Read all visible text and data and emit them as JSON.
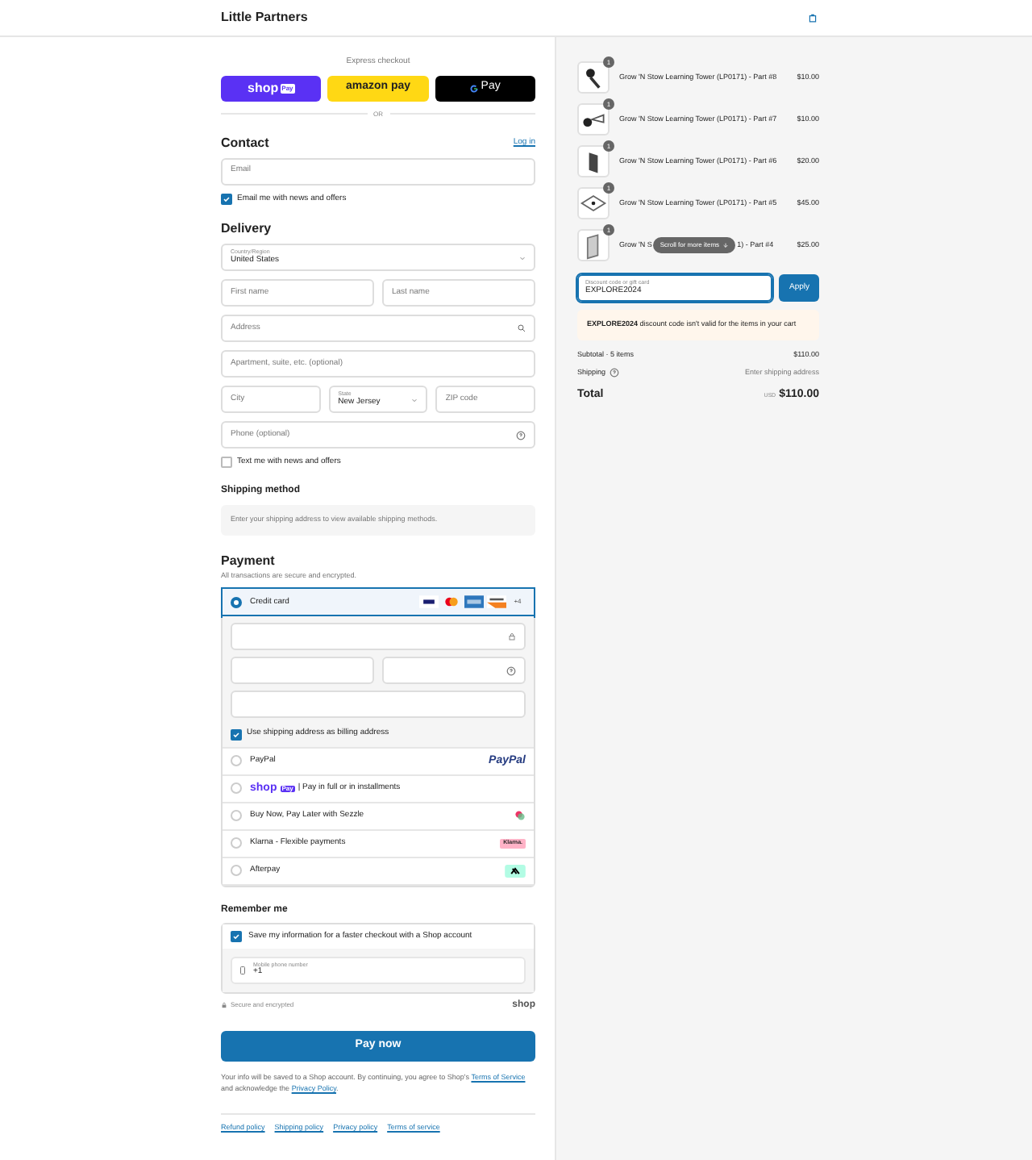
{
  "header": {
    "store": "Little Partners"
  },
  "express": {
    "title": "Express checkout",
    "buttons": [
      {
        "kind": "shop",
        "label": "shop",
        "tag": "Pay"
      },
      {
        "kind": "amazon",
        "label": "amazon pay"
      },
      {
        "kind": "gpay",
        "label": "Pay"
      }
    ],
    "divider": "OR"
  },
  "contact": {
    "title": "Contact",
    "login": "Log in",
    "email": {
      "placeholder": "Email"
    },
    "news": {
      "label": "Email me with news and offers",
      "checked": true
    }
  },
  "delivery": {
    "title": "Delivery",
    "country": {
      "label": "Country/Region",
      "value": "United States"
    },
    "first_name": {
      "placeholder": "First name"
    },
    "last_name": {
      "placeholder": "Last name"
    },
    "address": {
      "placeholder": "Address"
    },
    "apartment": {
      "placeholder": "Apartment, suite, etc. (optional)"
    },
    "city": {
      "placeholder": "City"
    },
    "state": {
      "label": "State",
      "value": "New Jersey"
    },
    "zip": {
      "placeholder": "ZIP code"
    },
    "phone": {
      "placeholder": "Phone (optional)"
    },
    "sms": {
      "label": "Text me with news and offers",
      "checked": false
    }
  },
  "shipping_method": {
    "title": "Shipping method",
    "message": "Enter your shipping address to view available shipping methods."
  },
  "payment": {
    "title": "Payment",
    "subtitle": "All transactions are secure and encrypted.",
    "billing": {
      "label": "Use shipping address as billing address",
      "checked": true
    },
    "methods": [
      {
        "kind": "card",
        "label": "Credit card",
        "selected": true,
        "more": "+4"
      },
      {
        "kind": "paypal",
        "label": "PayPal",
        "logo": "PayPal",
        "selected": false
      },
      {
        "kind": "shop",
        "logo": "shop",
        "tag": "Pay",
        "label": "| Pay in full or in installments",
        "selected": false
      },
      {
        "kind": "sezzle",
        "label": "Buy Now, Pay Later with Sezzle",
        "selected": false
      },
      {
        "kind": "klarna",
        "label": "Klarna - Flexible payments",
        "logo": "Klarna.",
        "selected": false
      },
      {
        "kind": "afterpay",
        "label": "Afterpay",
        "selected": false
      }
    ]
  },
  "remember": {
    "title": "Remember me",
    "save": {
      "label": "Save my information for a faster checkout with a Shop account",
      "checked": true
    },
    "phone": {
      "label": "Mobile phone number",
      "value": "+1"
    },
    "secure": "Secure and encrypted",
    "shop_logo": "shop"
  },
  "pay_button": "Pay now",
  "notice": {
    "before": "Your info will be saved to a Shop account. By continuing, you agree to Shop's",
    "terms": "Terms of Service",
    "middle": "and acknowledge the",
    "privacy": "Privacy Policy",
    "after": "."
  },
  "footer": {
    "links": [
      "Refund policy",
      "Shipping policy",
      "Privacy policy",
      "Terms of service"
    ]
  },
  "cart": {
    "items": [
      {
        "kind": "full",
        "quantity": "1",
        "name": "Grow 'N Stow Learning Tower (LP0171) - Part #8",
        "price": "$10.00"
      },
      {
        "kind": "full",
        "quantity": "1",
        "name": "Grow 'N Stow Learning Tower (LP0171) - Part #7",
        "price": "$10.00"
      },
      {
        "kind": "full",
        "quantity": "1",
        "name": "Grow 'N Stow Learning Tower (LP0171) - Part #6",
        "price": "$20.00"
      },
      {
        "kind": "full",
        "quantity": "1",
        "name": "Grow 'N Stow Learning Tower (LP0171) - Part #5",
        "price": "$45.00"
      },
      {
        "kind": "covered",
        "quantity": "1",
        "name_start": "Grow 'N S",
        "name_end": "1) - Part #4",
        "price": "$25.00"
      }
    ],
    "scroll_hint": "Scroll for more items",
    "discount": {
      "label": "Discount code or gift card",
      "value": "EXPLORE2024",
      "button": "Apply"
    },
    "warning": {
      "code": "EXPLORE2024",
      "message": "discount code isn't valid for the items in your cart"
    },
    "subtotal": {
      "label": "Subtotal · 5 items",
      "value": "$110.00"
    },
    "shipping": {
      "label": "Shipping",
      "value": "Enter shipping address"
    },
    "total": {
      "label": "Total",
      "currency": "USD",
      "value": "$110.00"
    }
  }
}
